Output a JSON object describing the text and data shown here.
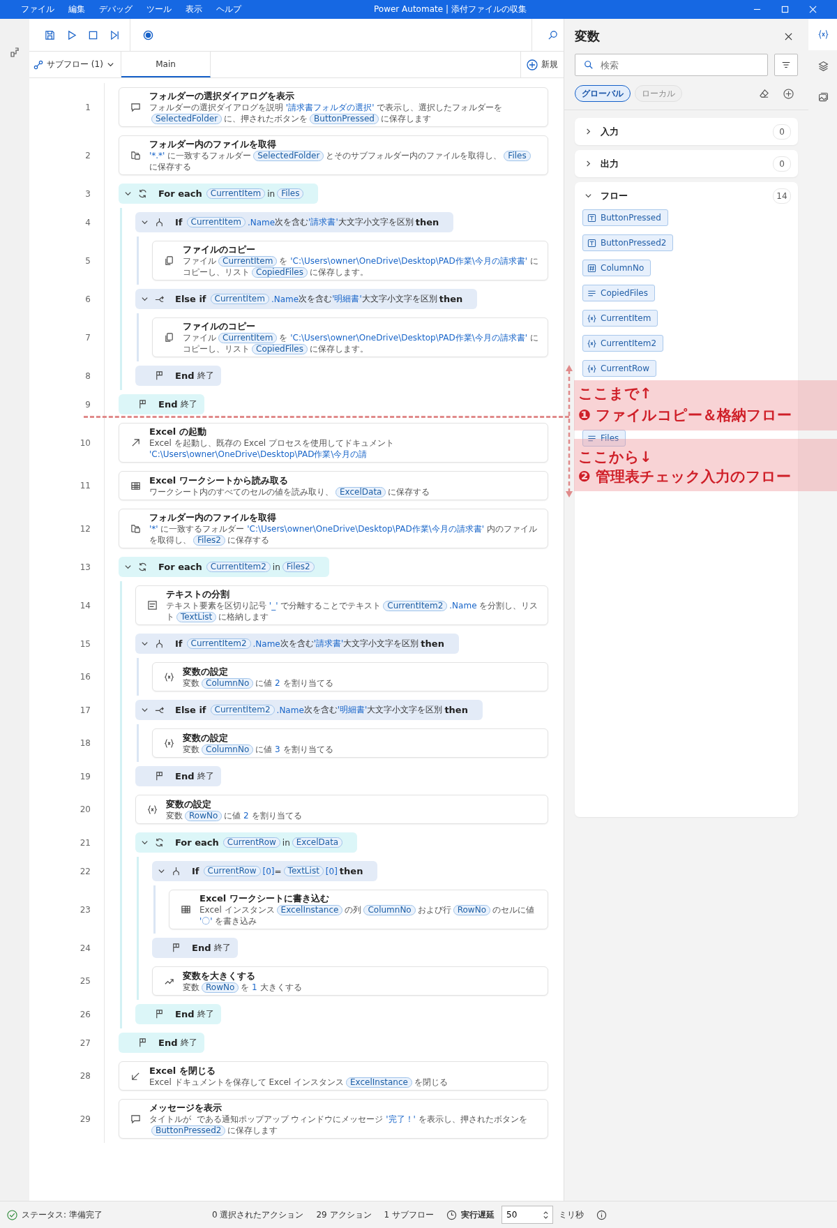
{
  "window": {
    "menu": [
      "ファイル",
      "編集",
      "デバッグ",
      "ツール",
      "表示",
      "ヘルプ"
    ],
    "title": "Power Automate | 添付ファイルの収集"
  },
  "subflows": {
    "dropdown": "サブフロー (1)",
    "tabs": [
      {
        "label": "Main",
        "selected": true
      }
    ],
    "new_button": "新規"
  },
  "steps": [
    {
      "kind": "message",
      "number": "1",
      "title": "フォルダーの選択ダイアログを表示",
      "description": [
        {
          "kind": "text",
          "text": "フォルダーの選択ダイアログを説明 "
        },
        {
          "kind": "lit",
          "text": "'請求書フォルダの選択'"
        },
        {
          "kind": "text",
          "text": " で表示し、選択したフォルダーを"
        },
        {
          "kind": "var",
          "text": "SelectedFolder"
        },
        {
          "kind": "text",
          "text": "に、押されたボタンを"
        },
        {
          "kind": "var",
          "text": "ButtonPressed"
        },
        {
          "kind": "text",
          "text": "に保存します"
        }
      ]
    },
    {
      "kind": "folder",
      "number": "2",
      "title": "フォルダー内のファイルを取得",
      "description": [
        {
          "kind": "lit",
          "text": "'*.*'"
        },
        {
          "kind": "text",
          "text": " に一致するフォルダー"
        },
        {
          "kind": "var",
          "text": "SelectedFolder"
        },
        {
          "kind": "text",
          "text": "とそのサブフォルダー内のファイルを取得し、"
        },
        {
          "kind": "var",
          "text": "Files"
        },
        {
          "kind": "text",
          "text": "に保存する"
        }
      ]
    },
    {
      "kind": "loop",
      "number": "3",
      "expanded": true,
      "header": [
        {
          "kind": "kw",
          "text": "For each"
        },
        {
          "kind": "var",
          "text": "CurrentItem"
        },
        {
          "kind": "text",
          "text": "in"
        },
        {
          "kind": "var",
          "text": "Files"
        }
      ],
      "children": [
        {
          "kind": "if",
          "number": "4",
          "expanded": true,
          "header": [
            {
              "kind": "kw",
              "text": "If"
            },
            {
              "kind": "var",
              "text": "CurrentItem"
            },
            {
              "kind": "lit",
              "text": ".Name"
            },
            {
              "kind": "text",
              "text": "次を含む"
            },
            {
              "kind": "lit",
              "text": "'請求書'"
            },
            {
              "kind": "text",
              "text": "大文字小文字を区別"
            },
            {
              "kind": "kw",
              "text": "then"
            }
          ],
          "children": [
            {
              "kind": "copy",
              "number": "5",
              "title": "ファイルのコピー",
              "description": [
                {
                  "kind": "text",
                  "text": "ファイル"
                },
                {
                  "kind": "var",
                  "text": "CurrentItem"
                },
                {
                  "kind": "text",
                  "text": "を "
                },
                {
                  "kind": "lit",
                  "text": "'C:\\Users\\owner\\OneDrive\\Desktop\\PAD作業\\今月の請求書'"
                },
                {
                  "kind": "text",
                  "text": " にコピーし、リスト"
                },
                {
                  "kind": "var",
                  "text": "CopiedFiles"
                },
                {
                  "kind": "text",
                  "text": "に保存します。"
                }
              ]
            }
          ]
        },
        {
          "kind": "elseif",
          "number": "6",
          "expanded": true,
          "header": [
            {
              "kind": "kw",
              "text": "Else if"
            },
            {
              "kind": "var",
              "text": "CurrentItem"
            },
            {
              "kind": "lit",
              "text": ".Name"
            },
            {
              "kind": "text",
              "text": "次を含む"
            },
            {
              "kind": "lit",
              "text": "'明細書'"
            },
            {
              "kind": "text",
              "text": "大文字小文字を区別"
            },
            {
              "kind": "kw",
              "text": "then"
            }
          ],
          "children": [
            {
              "kind": "copy",
              "number": "7",
              "title": "ファイルのコピー",
              "description": [
                {
                  "kind": "text",
                  "text": "ファイル"
                },
                {
                  "kind": "var",
                  "text": "CurrentItem"
                },
                {
                  "kind": "text",
                  "text": "を "
                },
                {
                  "kind": "lit",
                  "text": "'C:\\Users\\owner\\OneDrive\\Desktop\\PAD作業\\今月の請求書'"
                },
                {
                  "kind": "text",
                  "text": " にコピーし、リスト"
                },
                {
                  "kind": "var",
                  "text": "CopiedFiles"
                },
                {
                  "kind": "text",
                  "text": "に保存します。"
                }
              ]
            }
          ]
        },
        {
          "kind": "end",
          "number": "8",
          "keyword": "End",
          "label": "終了"
        }
      ]
    },
    {
      "kind": "end",
      "number": "9",
      "keyword": "End",
      "label": "終了"
    },
    {
      "kind": "launch",
      "number": "10",
      "title": "Excel の起動",
      "description": [
        {
          "kind": "text",
          "text": "Excel を起動し、既存の Excel プロセスを使用してドキュメント "
        },
        {
          "kind": "lit",
          "text": "'C:\\Users\\owner\\OneDrive\\Desktop\\PAD作業\\今月の請"
        }
      ]
    },
    {
      "kind": "sheet",
      "number": "11",
      "title": "Excel ワークシートから読み取る",
      "description": [
        {
          "kind": "text",
          "text": "ワークシート内のすべてのセルの値を読み取り、"
        },
        {
          "kind": "var",
          "text": "ExcelData"
        },
        {
          "kind": "text",
          "text": "に保存する"
        }
      ]
    },
    {
      "kind": "folder",
      "number": "12",
      "title": "フォルダー内のファイルを取得",
      "description": [
        {
          "kind": "lit",
          "text": "'*'"
        },
        {
          "kind": "text",
          "text": " に一致するフォルダー "
        },
        {
          "kind": "lit",
          "text": "'C:\\Users\\owner\\OneDrive\\Desktop\\PAD作業\\今月の請求書'"
        },
        {
          "kind": "text",
          "text": " 内のファイルを取得し、"
        },
        {
          "kind": "var",
          "text": "Files2"
        },
        {
          "kind": "text",
          "text": "に保存する"
        }
      ]
    },
    {
      "kind": "loop",
      "number": "13",
      "expanded": true,
      "header": [
        {
          "kind": "kw",
          "text": "For each"
        },
        {
          "kind": "var",
          "text": "CurrentItem2"
        },
        {
          "kind": "text",
          "text": "in"
        },
        {
          "kind": "var",
          "text": "Files2"
        }
      ],
      "children": [
        {
          "kind": "textsplit",
          "number": "14",
          "title": "テキストの分割",
          "description": [
            {
              "kind": "text",
              "text": "テキスト要素を区切り記号 "
            },
            {
              "kind": "lit",
              "text": "'_'"
            },
            {
              "kind": "text",
              "text": " で分離することでテキスト"
            },
            {
              "kind": "var",
              "text": "CurrentItem2"
            },
            {
              "kind": "lit",
              "text": ".Name"
            },
            {
              "kind": "text",
              "text": " を分割し、リスト"
            },
            {
              "kind": "var",
              "text": "TextList"
            },
            {
              "kind": "text",
              "text": "に格納します"
            }
          ]
        },
        {
          "kind": "if",
          "number": "15",
          "expanded": true,
          "header": [
            {
              "kind": "kw",
              "text": "If"
            },
            {
              "kind": "var",
              "text": "CurrentItem2"
            },
            {
              "kind": "lit",
              "text": ".Name"
            },
            {
              "kind": "text",
              "text": "次を含む"
            },
            {
              "kind": "lit",
              "text": "'請求書'"
            },
            {
              "kind": "text",
              "text": "大文字小文字を区別"
            },
            {
              "kind": "kw",
              "text": "then"
            }
          ],
          "children": [
            {
              "kind": "variable",
              "number": "16",
              "title": "変数の設定",
              "description": [
                {
                  "kind": "text",
                  "text": "変数"
                },
                {
                  "kind": "var",
                  "text": "ColumnNo"
                },
                {
                  "kind": "text",
                  "text": "に値 "
                },
                {
                  "kind": "lit",
                  "text": "2"
                },
                {
                  "kind": "text",
                  "text": " を割り当てる"
                }
              ]
            }
          ]
        },
        {
          "kind": "elseif",
          "number": "17",
          "expanded": true,
          "header": [
            {
              "kind": "kw",
              "text": "Else if"
            },
            {
              "kind": "var",
              "text": "CurrentItem2"
            },
            {
              "kind": "lit",
              "text": ".Name"
            },
            {
              "kind": "text",
              "text": "次を含む"
            },
            {
              "kind": "lit",
              "text": "'明細書'"
            },
            {
              "kind": "text",
              "text": "大文字小文字を区別"
            },
            {
              "kind": "kw",
              "text": "then"
            }
          ],
          "children": [
            {
              "kind": "variable",
              "number": "18",
              "title": "変数の設定",
              "description": [
                {
                  "kind": "text",
                  "text": "変数"
                },
                {
                  "kind": "var",
                  "text": "ColumnNo"
                },
                {
                  "kind": "text",
                  "text": "に値 "
                },
                {
                  "kind": "lit",
                  "text": "3"
                },
                {
                  "kind": "text",
                  "text": " を割り当てる"
                }
              ]
            }
          ]
        },
        {
          "kind": "end",
          "number": "19",
          "keyword": "End",
          "label": "終了"
        },
        {
          "kind": "variable",
          "number": "20",
          "title": "変数の設定",
          "description": [
            {
              "kind": "text",
              "text": "変数"
            },
            {
              "kind": "var",
              "text": "RowNo"
            },
            {
              "kind": "text",
              "text": "に値 "
            },
            {
              "kind": "lit",
              "text": "2"
            },
            {
              "kind": "text",
              "text": " を割り当てる"
            }
          ]
        },
        {
          "kind": "loop",
          "number": "21",
          "expanded": true,
          "header": [
            {
              "kind": "kw",
              "text": "For each"
            },
            {
              "kind": "var",
              "text": "CurrentRow"
            },
            {
              "kind": "text",
              "text": "in"
            },
            {
              "kind": "var",
              "text": "ExcelData"
            }
          ],
          "children": [
            {
              "kind": "if",
              "number": "22",
              "expanded": true,
              "header": [
                {
                  "kind": "kw",
                  "text": "If"
                },
                {
                  "kind": "var",
                  "text": "CurrentRow"
                },
                {
                  "kind": "lit",
                  "text": "[0]"
                },
                {
                  "kind": "text",
                  "text": "="
                },
                {
                  "kind": "var",
                  "text": "TextList"
                },
                {
                  "kind": "lit",
                  "text": "[0]"
                },
                {
                  "kind": "kw",
                  "text": "then"
                }
              ],
              "children": [
                {
                  "kind": "sheet",
                  "number": "23",
                  "title": "Excel ワークシートに書き込む",
                  "description": [
                    {
                      "kind": "text",
                      "text": "Excel インスタンス"
                    },
                    {
                      "kind": "var",
                      "text": "ExcelInstance"
                    },
                    {
                      "kind": "text",
                      "text": "の列"
                    },
                    {
                      "kind": "var",
                      "text": "ColumnNo"
                    },
                    {
                      "kind": "text",
                      "text": "および行"
                    },
                    {
                      "kind": "var",
                      "text": "RowNo"
                    },
                    {
                      "kind": "text",
                      "text": "のセルに値 "
                    },
                    {
                      "kind": "lit",
                      "text": "'〇'"
                    },
                    {
                      "kind": "text",
                      "text": " を書き込み"
                    }
                  ]
                }
              ]
            },
            {
              "kind": "end",
              "number": "24",
              "keyword": "End",
              "label": "終了"
            },
            {
              "kind": "increment",
              "number": "25",
              "title": "変数を大きくする",
              "description": [
                {
                  "kind": "text",
                  "text": "変数"
                },
                {
                  "kind": "var",
                  "text": "RowNo"
                },
                {
                  "kind": "text",
                  "text": "を "
                },
                {
                  "kind": "lit",
                  "text": "1"
                },
                {
                  "kind": "text",
                  "text": " 大きくする"
                }
              ]
            }
          ]
        },
        {
          "kind": "end",
          "number": "26",
          "keyword": "End",
          "label": "終了"
        }
      ]
    },
    {
      "kind": "end",
      "number": "27",
      "keyword": "End",
      "label": "終了"
    },
    {
      "kind": "close",
      "number": "28",
      "title": "Excel を閉じる",
      "description": [
        {
          "kind": "text",
          "text": "Excel ドキュメントを保存して Excel インスタンス"
        },
        {
          "kind": "var",
          "text": "ExcelInstance"
        },
        {
          "kind": "text",
          "text": "を閉じる"
        }
      ]
    },
    {
      "kind": "message",
      "number": "29",
      "title": "メッセージを表示",
      "description": [
        {
          "kind": "text",
          "text": "タイトルが  である通知ポップアップ ウィンドウにメッセージ "
        },
        {
          "kind": "lit",
          "text": "'完了！'"
        },
        {
          "kind": "text",
          "text": " を表示し、押されたボタンを"
        },
        {
          "kind": "var",
          "text": "ButtonPressed2"
        },
        {
          "kind": "text",
          "text": "に保存します"
        }
      ]
    }
  ],
  "variables_panel": {
    "title": "変数",
    "search": {
      "placeholder": "検索"
    },
    "scopes": [
      {
        "label": "グローバル",
        "selected": true
      },
      {
        "label": "ローカル",
        "selected": false
      }
    ],
    "sections": [
      {
        "label": "入力",
        "count": "0",
        "expanded": false
      },
      {
        "label": "出力",
        "count": "0",
        "expanded": false
      },
      {
        "label": "フロー",
        "count": "14",
        "expanded": true,
        "variables": [
          {
            "name": "ButtonPressed",
            "kind": "text"
          },
          {
            "name": "ButtonPressed2",
            "kind": "text"
          },
          {
            "name": "ColumnNo",
            "kind": "number"
          },
          {
            "name": "CopiedFiles",
            "kind": "list"
          },
          {
            "name": "CurrentItem",
            "kind": "generic"
          },
          {
            "name": "CurrentItem2",
            "kind": "generic"
          },
          {
            "name": "CurrentRow",
            "kind": "generic"
          },
          {
            "name": "Files",
            "kind": "list"
          }
        ]
      }
    ]
  },
  "side_tabs": [
    {
      "kind": "variables",
      "selected": true
    },
    {
      "kind": "layers",
      "selected": false
    },
    {
      "kind": "images",
      "selected": false
    }
  ],
  "annotations": [
    {
      "lines": [
        "ここまで↑",
        "❶ ファイルコピー＆格納フロー"
      ]
    },
    {
      "lines": [
        "ここから↓",
        "❷ 管理表チェック入力のフロー"
      ]
    }
  ],
  "status_bar": {
    "status": "ステータス: 準備完了",
    "selected_actions": "0 選択されたアクション",
    "actions": "29 アクション",
    "subflows": "1 サブフロー",
    "delay_label": "実行遅延",
    "delay_value": "50",
    "delay_unit": "ミリ秒"
  }
}
